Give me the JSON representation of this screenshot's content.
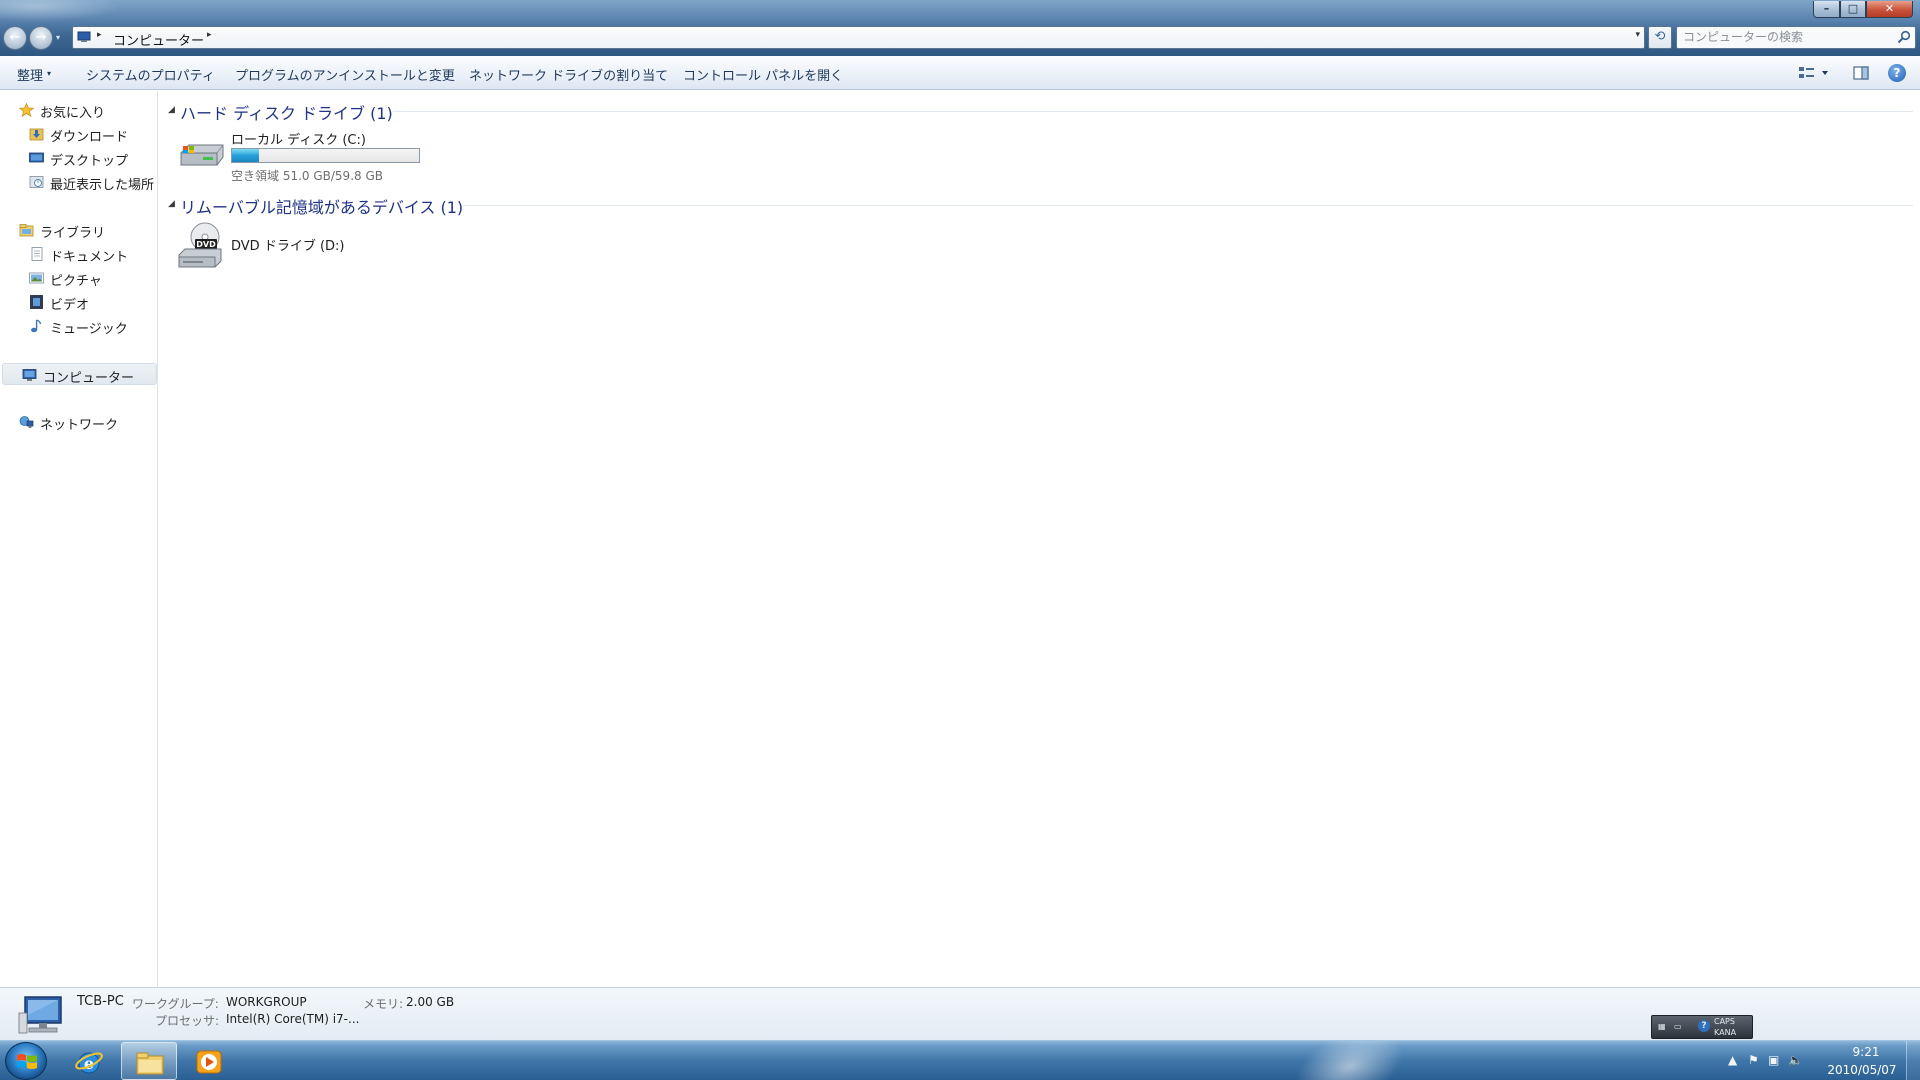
{
  "window": {
    "minimize_label": "–",
    "maximize_label": "□",
    "close_label": "✕"
  },
  "address_bar": {
    "back_label": "←",
    "forward_label": "→",
    "history_label": "▾",
    "separator": "▸",
    "crumb": "コンピューター",
    "dropdown_label": "▾",
    "refresh_label": "⟲"
  },
  "search": {
    "placeholder": "コンピューターの検索"
  },
  "command_bar": {
    "organize": "整理",
    "organize_arrow": "▾",
    "system_properties": "システムのプロパティ",
    "uninstall": "プログラムのアンインストールと変更",
    "map_drive": "ネットワーク ドライブの割り当て",
    "control_panel": "コントロール パネルを開く",
    "help_label": "?"
  },
  "nav_pane": {
    "favorites": "お気に入り",
    "favorites_items": [
      "ダウンロード",
      "デスクトップ",
      "最近表示した場所"
    ],
    "libraries": "ライブラリ",
    "libraries_items": [
      "ドキュメント",
      "ピクチャ",
      "ビデオ",
      "ミュージック"
    ],
    "computer": "コンピューター",
    "network": "ネットワーク"
  },
  "content": {
    "hdd_group": {
      "arrow": "◢",
      "title": "ハード ディスク ドライブ (1)",
      "drive": {
        "name": "ローカル ディスク (C:)",
        "free_text": "空き領域 51.0 GB/59.8 GB",
        "free_gb": 51.0,
        "total_gb": 59.8,
        "used_fraction": 0.147,
        "bar_color": "#26a0da"
      }
    },
    "removable_group": {
      "arrow": "◢",
      "title": "リムーバブル記憶域があるデバイス (1)",
      "drive": {
        "name": "DVD ドライブ (D:)",
        "badge": "DVD"
      }
    }
  },
  "details_pane": {
    "pc_name": "TCB-PC",
    "workgroup_label": "ワークグループ:",
    "workgroup_value": "WORKGROUP",
    "memory_label": "メモリ:",
    "memory_value": "2.00 GB",
    "processor_label": "プロセッサ:",
    "processor_value": "Intel(R) Core(TM) i7-..."
  },
  "language_bar": {
    "caps": "CAPS",
    "kana": "KANA",
    "help": "?"
  },
  "taskbar": {
    "apps": [
      "internet-explorer",
      "windows-explorer",
      "windows-media-player"
    ],
    "tray_arrow": "▲",
    "clock_time": "9:21",
    "clock_date": "2010/05/07"
  }
}
